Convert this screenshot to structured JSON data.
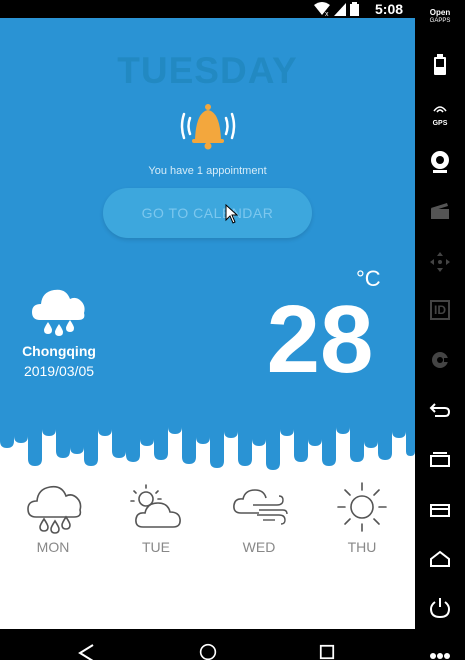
{
  "status_bar": {
    "time": "5:08"
  },
  "app": {
    "day": "TUESDAY",
    "appointment_text": "You have 1 appointment",
    "calendar_button": "GO TO CALENDAR",
    "city": "Chongqing",
    "date": "2019/03/05",
    "temperature": "28",
    "unit": "°C",
    "forecast": [
      {
        "day": "MON",
        "icon": "rain-cloud-icon"
      },
      {
        "day": "TUE",
        "icon": "sun-cloud-icon"
      },
      {
        "day": "WED",
        "icon": "wind-cloud-icon"
      },
      {
        "day": "THU",
        "icon": "sun-icon"
      }
    ]
  },
  "side_panel": {
    "brand_line1": "Open",
    "brand_line2": "GAPPS",
    "gps_label": "GPS",
    "id_label": "ID",
    "icons": [
      "battery-icon",
      "gps-icon",
      "camera-icon",
      "clapper-icon",
      "dpad-icon",
      "id-icon",
      "media-icon",
      "back-icon",
      "recents-icon",
      "menu-icon",
      "home-icon",
      "power-icon",
      "more-icon"
    ]
  },
  "nav_bar": {
    "icons": [
      "back-icon",
      "home-icon",
      "recents-icon"
    ]
  },
  "colors": {
    "hero_blue": "#2a93d4",
    "button_blue": "#3da7dd",
    "bell_orange": "#f3a73d",
    "text_gray": "#888888"
  }
}
